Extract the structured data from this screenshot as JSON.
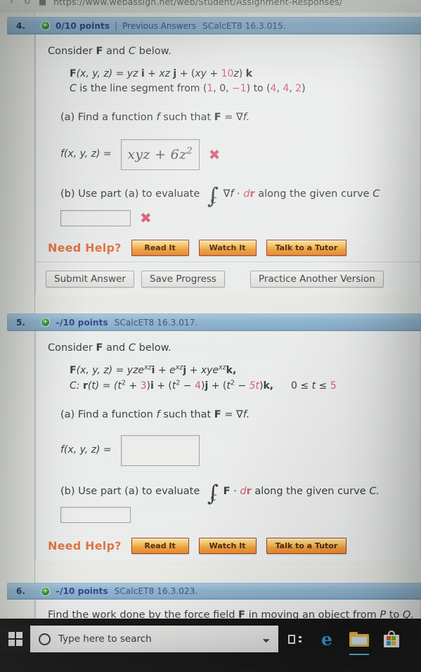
{
  "browser": {
    "back_icon": "back-arrow-icon",
    "refresh_icon": "refresh-icon",
    "stop_icon": "stop-icon",
    "url": "https://www.webassign.net/web/Student/Assignment-Responses/"
  },
  "questions": [
    {
      "number": "4.",
      "points": "0/10 points",
      "separator": "|",
      "previous_answers": "Previous Answers",
      "code": "SCalcET8 16.3.015.",
      "status_icon": "plus-circle-icon",
      "intro": "Consider",
      "intro_f": "F",
      "intro_and": "and",
      "intro_c": "C",
      "intro_below": "below.",
      "field_label": "F(x, y, z) =",
      "field_expr_1": "yz",
      "field_i": "i",
      "field_plus1": "+",
      "field_expr_2": "xz",
      "field_j": "j",
      "field_plus2": "+ (",
      "field_expr_3": "xy",
      "field_plus3": "+",
      "field_coef": "10",
      "field_z": "z",
      "field_close": ")",
      "field_k": "k",
      "curve_c": "C",
      "curve_desc": "is the line segment from (",
      "p1_x": "1",
      "p1_y": "0",
      "p1_z": "−1",
      "curve_to": ") to (",
      "p2_x": "4",
      "p2_y": "4",
      "p2_z": "2",
      "curve_end": ")",
      "part_a": "(a) Find a function",
      "part_a_f": "f",
      "part_a_such": "such that",
      "part_a_F": "F",
      "part_a_eq": "=",
      "part_a_grad": "∇f.",
      "answer_a_label": "f(x, y, z)  =",
      "answer_a_value": "xyz + 6z",
      "answer_a_exp": "2",
      "answer_a_mark": "✖",
      "part_b_pre": "(b) Use part (a) to evaluate",
      "part_b_integrand": "∇f",
      "part_b_dot": "·",
      "part_b_dr_d": "d",
      "part_b_dr_r": "r",
      "part_b_post": "along the given curve",
      "part_b_curve": "C",
      "integral_limit": "C",
      "answer_b_value": "",
      "answer_b_mark": "✖",
      "need_help_label": "Need Help?",
      "help_buttons": [
        "Read It",
        "Watch It",
        "Talk to a Tutor"
      ],
      "action_buttons": [
        "Submit Answer",
        "Save Progress",
        "Practice Another Version"
      ]
    },
    {
      "number": "5.",
      "points": "–/10 points",
      "code": "SCalcET8 16.3.017.",
      "status_icon": "plus-circle-icon",
      "intro": "Consider",
      "intro_f": "F",
      "intro_and": "and",
      "intro_c": "C",
      "intro_below": "below.",
      "field_label": "F(x, y, z) =",
      "field_t1": "yze",
      "field_t1_exp": "xz",
      "field_i": "i",
      "field_plus1": "+",
      "field_t2": "e",
      "field_t2_exp": "xz",
      "field_j": "j",
      "field_plus2": "+",
      "field_t3": "xye",
      "field_t3_exp": "xz",
      "field_k": "k,",
      "curve_label": "C:",
      "curve_r": "r",
      "curve_rt": "(t) = (",
      "c1_t": "t",
      "c1_exp": "2",
      "c1_op": "+",
      "c1_num": "3",
      "c1_close": ")",
      "c1_i": "i",
      "c2_plus": "+ (",
      "c2_t": "t",
      "c2_exp": "2",
      "c2_op": "−",
      "c2_num": "4",
      "c2_close": ")",
      "c2_j": "j",
      "c3_plus": "+ (",
      "c3_t": "t",
      "c3_exp": "2",
      "c3_op": "−",
      "c3_num": "5t",
      "c3_close": ")",
      "c3_k": "k,",
      "range_lo": "0",
      "range_le1": "≤",
      "range_t": "t",
      "range_le2": "≤",
      "range_hi": "5",
      "part_a": "(a) Find a function",
      "part_a_f": "f",
      "part_a_such": "such that",
      "part_a_F": "F",
      "part_a_eq": "=",
      "part_a_grad": "∇f.",
      "answer_a_label": "f(x, y, z)  =",
      "answer_a_value": "",
      "part_b_pre": "(b) Use part (a) to evaluate",
      "part_b_integrand": "F",
      "part_b_dot": "·",
      "part_b_dr_d": "d",
      "part_b_dr_r": "r",
      "part_b_post": "along the given curve",
      "part_b_curve": "C.",
      "integral_limit": "C",
      "answer_b_value": "",
      "need_help_label": "Need Help?",
      "help_buttons": [
        "Read It",
        "Watch It",
        "Talk to a Tutor"
      ]
    },
    {
      "number": "6.",
      "points": "–/10 points",
      "code": "SCalcET8 16.3.023.",
      "status_icon": "plus-circle-icon",
      "prompt_pre": "Find the work done by the force field",
      "prompt_F": "F",
      "prompt_mid": "in moving an object from",
      "prompt_P": "P",
      "prompt_to": "to",
      "prompt_Q": "Q."
    }
  ],
  "taskbar": {
    "start_icon": "windows-start-icon",
    "search_icon": "cortana-circle-icon",
    "search_placeholder": "Type here to search",
    "mic_icon": "microphone-icon",
    "taskview_icon": "task-view-icon",
    "edge_icon": "edge-browser-icon",
    "edge_glyph": "e",
    "explorer_icon": "file-explorer-icon",
    "store_icon": "microsoft-store-icon"
  }
}
